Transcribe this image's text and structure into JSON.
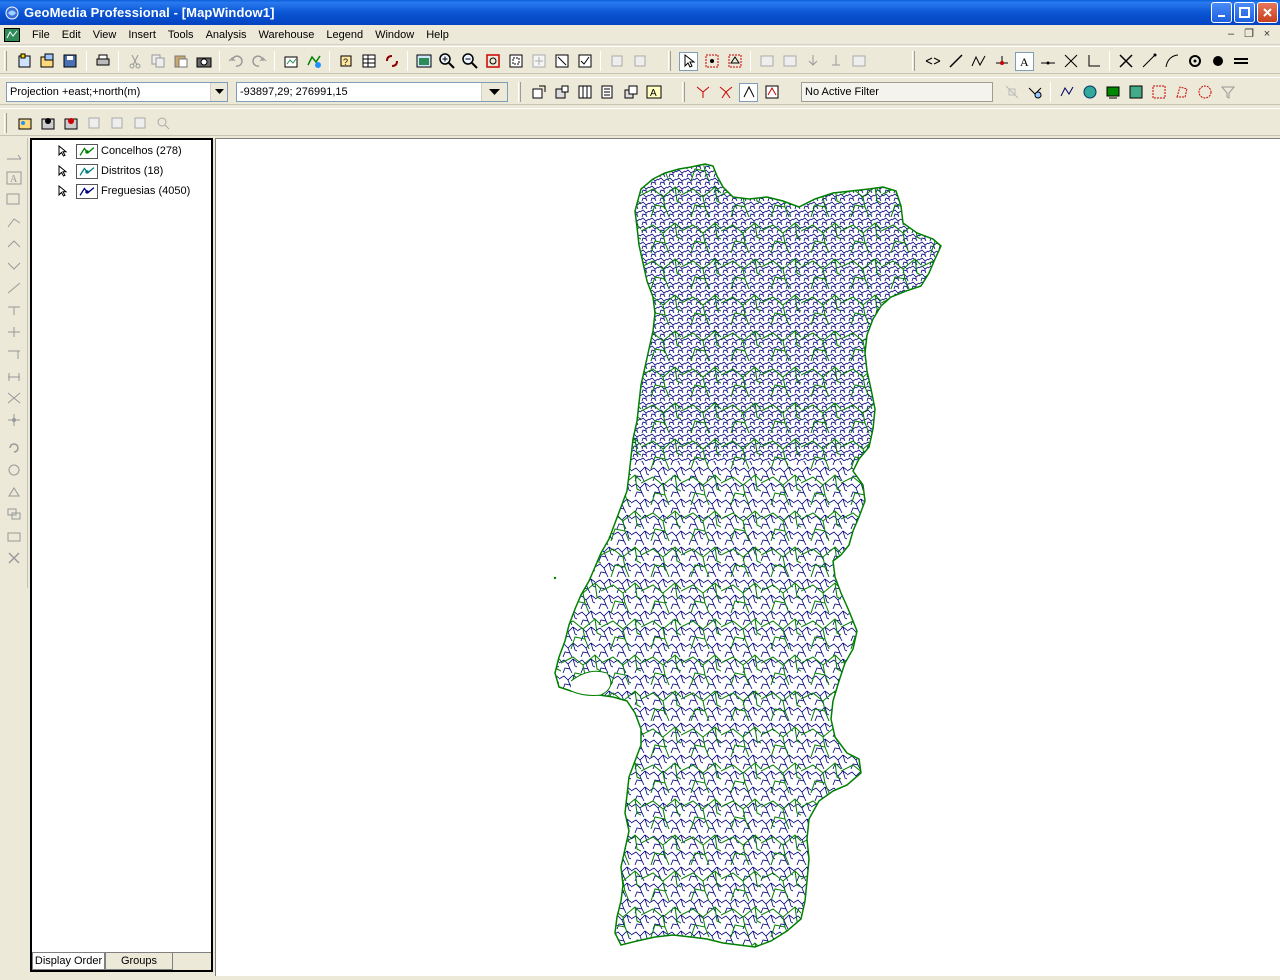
{
  "window": {
    "title": "GeoMedia Professional - [MapWindow1]"
  },
  "menu": [
    "File",
    "Edit",
    "View",
    "Insert",
    "Tools",
    "Analysis",
    "Warehouse",
    "Legend",
    "Window",
    "Help"
  ],
  "toolbar": {
    "projection_select": "Projection +east;+north(m)",
    "coordinate_readout": "-93897,29; 276991,15",
    "filter_status": "No Active Filter"
  },
  "legend": {
    "entries": [
      {
        "label": "Concelhos (278)",
        "color": "#008000"
      },
      {
        "label": "Distritos (18)",
        "color": "#008080"
      },
      {
        "label": "Freguesias (4050)",
        "color": "#000080"
      }
    ],
    "tabs": [
      "Display Order",
      "Groups"
    ]
  },
  "map": {
    "layer_colors": {
      "concelhos": "#008000",
      "freguesias": "#000080"
    }
  }
}
